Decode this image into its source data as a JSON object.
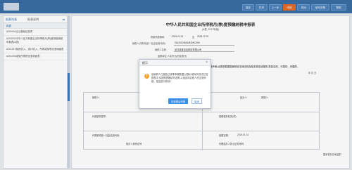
{
  "topbar": {
    "buttons": [
      {
        "label": "保存"
      },
      {
        "label": "打印"
      },
      {
        "label": "上一步"
      },
      {
        "label": "申报"
      },
      {
        "label": "关闭"
      },
      {
        "label": "填写说明"
      },
      {
        "label": "帮助"
      }
    ]
  },
  "sidebar": {
    "tab_active": "报表列表",
    "tab_other": "报表说明",
    "section_label": "报表",
    "items": [
      "A000000企业基础信息表",
      "A200000中华人民共和国企业所得税月(季)度预缴纳税申报表(A类)",
      "A201010免税收入、减计收入、所得减免等优惠明细表",
      "A201030减免所得税优惠明细表"
    ]
  },
  "form": {
    "title": "中华人民共和国企业所得税月(季)度预缴纳税申报表",
    "subtitle": "(A类, 2017年版)",
    "period_label": "税款所属期间:",
    "period_from": "2019-01-01",
    "period_to": "2019-12-31",
    "taxpayer_id_label": "纳税人识别号(统一社会信用代码):",
    "taxpayer_id": "91420104MA4K0HK2XM",
    "taxpayer_name_label": "纳税人名称:",
    "taxpayer_name": "武汉某某信息科技有限公司",
    "unit_label": "金额单位:人民币元(列至角分)",
    "note": "谨声明:此表是根据国家税收法律法规及相关规定填报的,是真实的、可靠的、完整的。",
    "date_label": "年   月   日",
    "table": {
      "taxpayer_seal": "纳税人:",
      "agent_label": "代理机构签章:",
      "tax_officer": "受理人:",
      "agent_rep": "经办人:",
      "agent_id": "代理机构统一社会信用代码:",
      "receive_label": "受理税务机关(章):",
      "accept_date_label": "受理日期:",
      "accept_date": "2019-01-10",
      "handler": "经办人身份证号:",
      "agent_name": "代理经办人执业证件号码:"
    },
    "footer_right": "国家税务总局监制"
  },
  "dialog": {
    "title": "提示",
    "message": "该纳税人已报告过该季申报数据,请核对!若填写情况已在报表中,请按照表格填写说明,以免影响办税人的正常申报。是否进行修改?",
    "primary_button": "去查看后申报",
    "cancel_button": "取消"
  }
}
